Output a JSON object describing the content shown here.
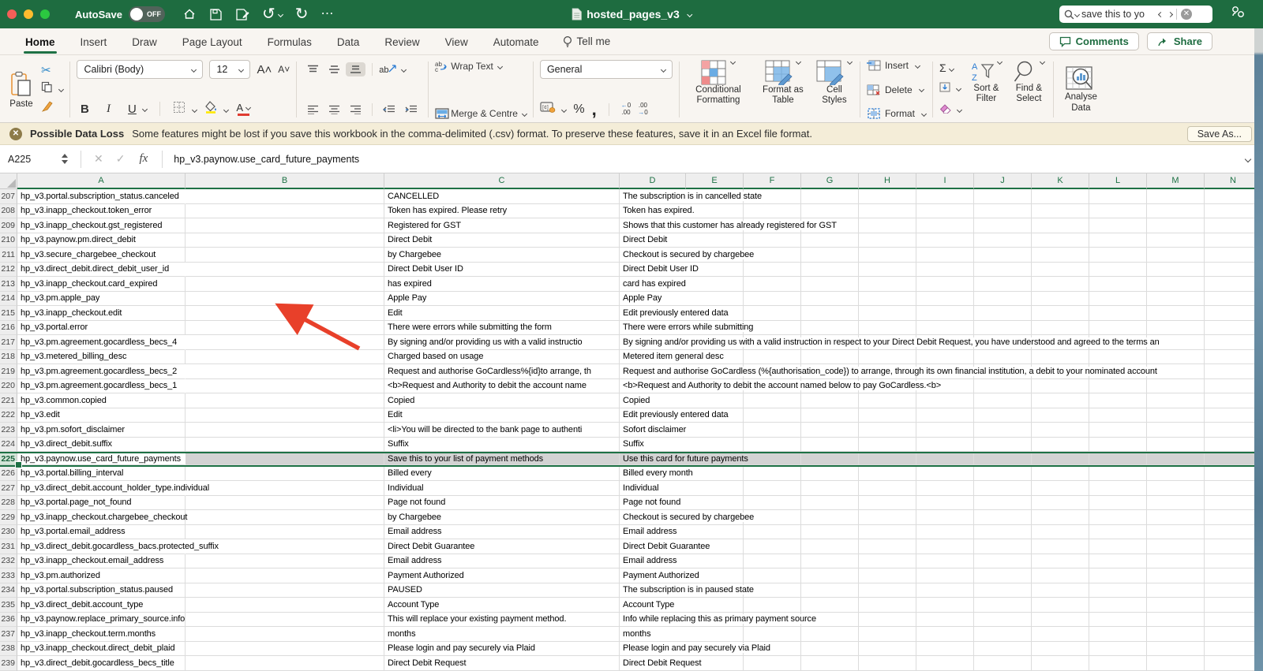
{
  "titlebar": {
    "autosave_label": "AutoSave",
    "autosave_state": "OFF",
    "doc_title": "hosted_pages_v3",
    "search_text": "save this to yo"
  },
  "tabs": [
    {
      "label": "Home",
      "active": true
    },
    {
      "label": "Insert",
      "active": false
    },
    {
      "label": "Draw",
      "active": false
    },
    {
      "label": "Page Layout",
      "active": false
    },
    {
      "label": "Formulas",
      "active": false
    },
    {
      "label": "Data",
      "active": false
    },
    {
      "label": "Review",
      "active": false
    },
    {
      "label": "View",
      "active": false
    },
    {
      "label": "Automate",
      "active": false
    }
  ],
  "tellme_label": "Tell me",
  "actions": {
    "comments": "Comments",
    "share": "Share"
  },
  "ribbon": {
    "paste": "Paste",
    "font_name": "Calibri (Body)",
    "font_size": "12",
    "bold": "B",
    "italic": "I",
    "underline": "U",
    "wrap_text": "Wrap Text",
    "merge_centre": "Merge & Centre",
    "number_format": "General",
    "percent": "%",
    "comma": ",",
    "conditional_formatting": "Conditional Formatting",
    "format_as_table": "Format as Table",
    "cell_styles": "Cell Styles",
    "insert": "Insert",
    "delete": "Delete",
    "format": "Format",
    "sort_filter": "Sort & Filter",
    "find_select": "Find & Select",
    "analyse_data": "Analyse Data"
  },
  "warning": {
    "title": "Possible Data Loss",
    "message": "Some features might be lost if you save this workbook in the comma-delimited (.csv) format. To preserve these features, save it in an Excel file format.",
    "save_as": "Save As..."
  },
  "formula_bar": {
    "name_box": "A225",
    "fx": "fx",
    "value": "hp_v3.paynow.use_card_future_payments"
  },
  "grid": {
    "columns": [
      "A",
      "B",
      "C",
      "D",
      "E",
      "F",
      "G",
      "H",
      "I",
      "J",
      "K",
      "L",
      "M",
      "N"
    ],
    "selected_row": "225",
    "rows": [
      {
        "n": "207",
        "a": "hp_v3.portal.subscription_status.canceled",
        "c": "CANCELLED",
        "d": "The subscription is in cancelled state",
        "ov": true
      },
      {
        "n": "208",
        "a": "hp_v3.inapp_checkout.token_error",
        "c": "Token has expired. Please retry",
        "d": "Token has expired.",
        "ov": false
      },
      {
        "n": "209",
        "a": "hp_v3.inapp_checkout.gst_registered",
        "c": "Registered for GST",
        "d": "Shows that this customer has already registered for GST",
        "ov": false
      },
      {
        "n": "210",
        "a": "hp_v3.paynow.pm.direct_debit",
        "c": "Direct Debit",
        "d": "Direct Debit",
        "ov": false
      },
      {
        "n": "211",
        "a": "hp_v3.secure_chargebee_checkout",
        "c": "by Chargebee",
        "d": "Checkout is secured by chargebee",
        "ov": false
      },
      {
        "n": "212",
        "a": "hp_v3.direct_debit.direct_debit_user_id",
        "c": "Direct Debit User ID",
        "d": "Direct Debit User ID",
        "ov": true
      },
      {
        "n": "213",
        "a": "hp_v3.inapp_checkout.card_expired",
        "c": "has expired",
        "d": "card has expired",
        "ov": false
      },
      {
        "n": "214",
        "a": "hp_v3.pm.apple_pay",
        "c": "Apple Pay",
        "d": "Apple Pay",
        "ov": false
      },
      {
        "n": "215",
        "a": "hp_v3.inapp_checkout.edit",
        "c": "Edit",
        "d": "Edit previously entered data",
        "ov": false
      },
      {
        "n": "216",
        "a": "hp_v3.portal.error",
        "c": "There were errors while submitting the form",
        "d": "There were errors while submitting",
        "ov": false
      },
      {
        "n": "217",
        "a": "hp_v3.pm.agreement.gocardless_becs_4",
        "c": "By signing and/or providing us with a valid instructio",
        "d": "By signing and/or providing us with a valid instruction in respect to your Direct Debit Request, you have understood and agreed to the terms an",
        "ov": true
      },
      {
        "n": "218",
        "a": "hp_v3.metered_billing_desc",
        "c": "Charged based on usage",
        "d": "Metered item general desc",
        "ov": false
      },
      {
        "n": "219",
        "a": "hp_v3.pm.agreement.gocardless_becs_2",
        "c": "Request and authorise GoCardless%{id}to arrange, th",
        "d": "Request and authorise GoCardless (%{authorisation_code}) to arrange, through its own financial institution, a debit to your nominated account",
        "ov": true
      },
      {
        "n": "220",
        "a": "hp_v3.pm.agreement.gocardless_becs_1",
        "c": "<b>Request and Authority to debit the account name",
        "d": "<b>Request and Authority to debit the account named below to pay GoCardless.<b>",
        "ov": true
      },
      {
        "n": "221",
        "a": "hp_v3.common.copied",
        "c": "Copied",
        "d": "Copied",
        "ov": false
      },
      {
        "n": "222",
        "a": "hp_v3.edit",
        "c": "Edit",
        "d": "Edit previously entered data",
        "ov": false
      },
      {
        "n": "223",
        "a": "hp_v3.pm.sofort_disclaimer",
        "c": "<li>You will be directed to the bank page to authenti",
        "d": "Sofort disclaimer",
        "ov": false
      },
      {
        "n": "224",
        "a": "hp_v3.direct_debit.suffix",
        "c": "Suffix",
        "d": "Suffix",
        "ov": false
      },
      {
        "n": "225",
        "a": "hp_v3.paynow.use_card_future_payments",
        "c": "Save this to your list of payment methods",
        "d": "Use this card for future payments",
        "ov": true
      },
      {
        "n": "226",
        "a": "hp_v3.portal.billing_interval",
        "c": "Billed every",
        "d": "Billed every month",
        "ov": false
      },
      {
        "n": "227",
        "a": "hp_v3.direct_debit.account_holder_type.individual",
        "c": "Individual",
        "d": "Individual",
        "ov": true
      },
      {
        "n": "228",
        "a": "hp_v3.portal.page_not_found",
        "c": "Page not found",
        "d": "Page not found",
        "ov": false
      },
      {
        "n": "229",
        "a": "hp_v3.inapp_checkout.chargebee_checkout",
        "c": "by Chargebee",
        "d": "Checkout is secured by chargebee",
        "ov": false
      },
      {
        "n": "230",
        "a": "hp_v3.portal.email_address",
        "c": "Email address",
        "d": "Email address",
        "ov": false
      },
      {
        "n": "231",
        "a": "hp_v3.direct_debit.gocardless_bacs.protected_suffix",
        "c": "Direct Debit Guarantee",
        "d": "Direct Debit Guarantee",
        "ov": true
      },
      {
        "n": "232",
        "a": "hp_v3.inapp_checkout.email_address",
        "c": "Email address",
        "d": "Email address",
        "ov": false
      },
      {
        "n": "233",
        "a": "hp_v3.pm.authorized",
        "c": "Payment Authorized",
        "d": "Payment Authorized",
        "ov": false
      },
      {
        "n": "234",
        "a": "hp_v3.portal.subscription_status.paused",
        "c": "PAUSED",
        "d": "The subscription is in paused state",
        "ov": false
      },
      {
        "n": "235",
        "a": "hp_v3.direct_debit.account_type",
        "c": "Account Type",
        "d": "Account Type",
        "ov": false
      },
      {
        "n": "236",
        "a": "hp_v3.paynow.replace_primary_source.info",
        "c": "This will replace your existing payment method.",
        "d": "Info while replacing this as primary payment source",
        "ov": false
      },
      {
        "n": "237",
        "a": "hp_v3.inapp_checkout.term.months",
        "c": "months",
        "d": "months",
        "ov": false
      },
      {
        "n": "238",
        "a": "hp_v3.inapp_checkout.direct_debit_plaid",
        "c": "Please login and pay securely via Plaid",
        "d": "Please login and pay securely via Plaid",
        "ov": false
      },
      {
        "n": "239",
        "a": "hp_v3.direct_debit.gocardless_becs_title",
        "c": "Direct Debit Request",
        "d": "Direct Debit Request",
        "ov": false
      }
    ]
  },
  "colors": {
    "brand_green": "#1e6c40",
    "selection_border": "#1e7145",
    "selection_fill": "#d3d3d3",
    "warning_bg": "#f4edd8",
    "arrow_red": "#e8402a"
  }
}
